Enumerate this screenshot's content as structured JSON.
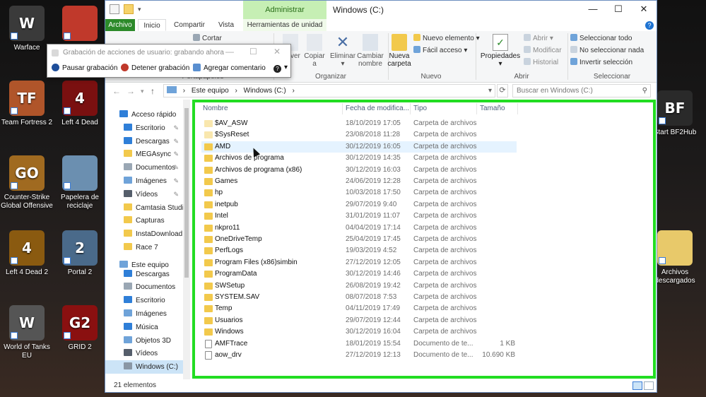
{
  "desktop": {
    "left_icons": [
      {
        "label": "Warface",
        "glyph": "W",
        "color": "#3a3a3a"
      },
      {
        "label": "",
        "glyph": "",
        "color": "#c0392b"
      },
      {
        "label": "Team Fortress 2",
        "glyph": "TF",
        "color": "#b0552a"
      },
      {
        "label": "Left 4 Dead",
        "glyph": "4",
        "color": "#7a1010"
      },
      {
        "label": "Counter-Strike Global Offensive",
        "glyph": "GO",
        "color": "#a06a20"
      },
      {
        "label": "Papelera de reciclaje",
        "glyph": "",
        "color": "#6b8fb0"
      },
      {
        "label": "Left 4 Dead 2",
        "glyph": "4",
        "color": "#8a5a10"
      },
      {
        "label": "Portal 2",
        "glyph": "2",
        "color": "#4a6a8a"
      },
      {
        "label": "World of Tanks EU",
        "glyph": "W",
        "color": "#555555"
      },
      {
        "label": "GRID 2",
        "glyph": "G2",
        "color": "#8a1010"
      }
    ],
    "right_icons": [
      {
        "label": "Start BF2Hub",
        "glyph": "BF",
        "color": "#2a2a2a"
      },
      {
        "label": "Archivos descargados",
        "glyph": "",
        "color": "#e8c96a"
      }
    ]
  },
  "window": {
    "title": "Windows (C:)",
    "manage_tab": "Administrar",
    "controls": {
      "minimize": "—",
      "maximize": "☐",
      "close": "✕"
    },
    "tabs": [
      "Archivo",
      "Inicio",
      "Compartir",
      "Vista",
      "Herramientas de unidad"
    ],
    "help": "?"
  },
  "ribbon": {
    "portapapeles": {
      "group": "Portapapeles",
      "cut": "Cortar",
      "copy_to": "Copiar a",
      "move_to": "Mover a"
    },
    "organizar": {
      "group": "Organizar",
      "move": "Mover",
      "copy": "Copiar",
      "delete": "Eliminar",
      "rename": "Cambiar nombre"
    },
    "nuevo": {
      "group": "Nuevo",
      "new_folder": "Nueva carpeta",
      "new_item": "Nuevo elemento",
      "easy_access": "Fácil acceso"
    },
    "abrir": {
      "group": "Abrir",
      "properties": "Propiedades",
      "open": "Abrir",
      "edit": "Modificar",
      "history": "Historial"
    },
    "seleccionar": {
      "group": "Seleccionar",
      "select_all": "Seleccionar todo",
      "select_none": "No seleccionar nada",
      "invert": "Invertir selección"
    }
  },
  "steps_recorder": {
    "title": "Grabación de acciones de usuario: grabando ahora",
    "pause": "Pausar grabación",
    "stop": "Detener grabación",
    "comment": "Agregar comentario",
    "help": "?"
  },
  "address": {
    "crumbs": [
      "Este equipo",
      "Windows (C:)"
    ],
    "separator": "›",
    "search_placeholder": "Buscar en Windows (C:)"
  },
  "nav_pane": [
    {
      "label": "Acceso rápido",
      "icon": "star-icon",
      "color": "#2f7fd8",
      "pin": false,
      "indent": 0
    },
    {
      "label": "Escritorio",
      "icon": "desktop-icon",
      "color": "#2f7fd8",
      "pin": true,
      "indent": 1
    },
    {
      "label": "Descargas",
      "icon": "download-icon",
      "color": "#2f7fd8",
      "pin": true,
      "indent": 1
    },
    {
      "label": "MEGAsync",
      "icon": "folder-icon",
      "color": "#f2c94c",
      "pin": true,
      "indent": 1
    },
    {
      "label": "Documentos",
      "icon": "document-icon",
      "color": "#9aa7b4",
      "pin": true,
      "indent": 1
    },
    {
      "label": "Imágenes",
      "icon": "image-icon",
      "color": "#6fa3d9",
      "pin": true,
      "indent": 1
    },
    {
      "label": "Vídeos",
      "icon": "video-icon",
      "color": "#555e6b",
      "pin": true,
      "indent": 1
    },
    {
      "label": "Camtasia Studio",
      "icon": "folder-icon",
      "color": "#f2c94c",
      "pin": false,
      "indent": 1
    },
    {
      "label": "Capturas",
      "icon": "folder-icon",
      "color": "#f2c94c",
      "pin": false,
      "indent": 1
    },
    {
      "label": "InstaDownload",
      "icon": "folder-icon",
      "color": "#f2c94c",
      "pin": false,
      "indent": 1
    },
    {
      "label": "Race 7",
      "icon": "folder-icon",
      "color": "#f2c94c",
      "pin": false,
      "indent": 1
    },
    {
      "label": "Este equipo",
      "icon": "computer-icon",
      "color": "#6fa3d9",
      "pin": false,
      "indent": 0
    },
    {
      "label": "Descargas",
      "icon": "download-icon",
      "color": "#2f7fd8",
      "pin": false,
      "indent": 1
    },
    {
      "label": "Documentos",
      "icon": "document-icon",
      "color": "#9aa7b4",
      "pin": false,
      "indent": 1
    },
    {
      "label": "Escritorio",
      "icon": "desktop-icon",
      "color": "#2f7fd8",
      "pin": false,
      "indent": 1
    },
    {
      "label": "Imágenes",
      "icon": "image-icon",
      "color": "#6fa3d9",
      "pin": false,
      "indent": 1
    },
    {
      "label": "Música",
      "icon": "music-icon",
      "color": "#2f7fd8",
      "pin": false,
      "indent": 1
    },
    {
      "label": "Objetos 3D",
      "icon": "cube-icon",
      "color": "#6fa3d9",
      "pin": false,
      "indent": 1
    },
    {
      "label": "Vídeos",
      "icon": "video-icon",
      "color": "#555e6b",
      "pin": false,
      "indent": 1
    },
    {
      "label": "Windows (C:)",
      "icon": "drive-icon",
      "color": "#8a97a5",
      "pin": false,
      "indent": 1,
      "selected": true
    }
  ],
  "file_list": {
    "columns": [
      "Nombre",
      "Fecha de modifica...",
      "Tipo",
      "Tamaño"
    ],
    "rows": [
      {
        "name": "$AV_ASW",
        "date": "18/10/2019 17:05",
        "type": "Carpeta de archivos",
        "size": "",
        "kind": "folder-faded"
      },
      {
        "name": "$SysReset",
        "date": "23/08/2018 11:28",
        "type": "Carpeta de archivos",
        "size": "",
        "kind": "folder-faded"
      },
      {
        "name": "AMD",
        "date": "30/12/2019 16:05",
        "type": "Carpeta de archivos",
        "size": "",
        "kind": "folder",
        "hover": true
      },
      {
        "name": "Archivos de programa",
        "date": "30/12/2019 14:35",
        "type": "Carpeta de archivos",
        "size": "",
        "kind": "folder"
      },
      {
        "name": "Archivos de programa (x86)",
        "date": "30/12/2019 16:03",
        "type": "Carpeta de archivos",
        "size": "",
        "kind": "folder"
      },
      {
        "name": "Games",
        "date": "24/06/2019 12:28",
        "type": "Carpeta de archivos",
        "size": "",
        "kind": "folder"
      },
      {
        "name": "hp",
        "date": "10/03/2018 17:50",
        "type": "Carpeta de archivos",
        "size": "",
        "kind": "folder"
      },
      {
        "name": "inetpub",
        "date": "29/07/2019 9:40",
        "type": "Carpeta de archivos",
        "size": "",
        "kind": "folder"
      },
      {
        "name": "Intel",
        "date": "31/01/2019 11:07",
        "type": "Carpeta de archivos",
        "size": "",
        "kind": "folder"
      },
      {
        "name": "nkpro11",
        "date": "04/04/2019 17:14",
        "type": "Carpeta de archivos",
        "size": "",
        "kind": "folder"
      },
      {
        "name": "OneDriveTemp",
        "date": "25/04/2019 17:45",
        "type": "Carpeta de archivos",
        "size": "",
        "kind": "folder"
      },
      {
        "name": "PerfLogs",
        "date": "19/03/2019 4:52",
        "type": "Carpeta de archivos",
        "size": "",
        "kind": "folder"
      },
      {
        "name": "Program Files (x86)simbin",
        "date": "27/12/2019 12:05",
        "type": "Carpeta de archivos",
        "size": "",
        "kind": "folder"
      },
      {
        "name": "ProgramData",
        "date": "30/12/2019 14:46",
        "type": "Carpeta de archivos",
        "size": "",
        "kind": "folder"
      },
      {
        "name": "SWSetup",
        "date": "26/08/2019 19:42",
        "type": "Carpeta de archivos",
        "size": "",
        "kind": "folder"
      },
      {
        "name": "SYSTEM.SAV",
        "date": "08/07/2018 7:53",
        "type": "Carpeta de archivos",
        "size": "",
        "kind": "folder"
      },
      {
        "name": "Temp",
        "date": "04/11/2019 17:49",
        "type": "Carpeta de archivos",
        "size": "",
        "kind": "folder"
      },
      {
        "name": "Usuarios",
        "date": "29/07/2019 12:44",
        "type": "Carpeta de archivos",
        "size": "",
        "kind": "folder"
      },
      {
        "name": "Windows",
        "date": "30/12/2019 16:04",
        "type": "Carpeta de archivos",
        "size": "",
        "kind": "folder"
      },
      {
        "name": "AMFTrace",
        "date": "18/01/2019 15:54",
        "type": "Documento de te...",
        "size": "1 KB",
        "kind": "doc"
      },
      {
        "name": "aow_drv",
        "date": "27/12/2019 12:13",
        "type": "Documento de te...",
        "size": "10.690 KB",
        "kind": "doc"
      }
    ]
  },
  "status": {
    "count": "21 elementos"
  },
  "highlight_color": "#22dd22"
}
